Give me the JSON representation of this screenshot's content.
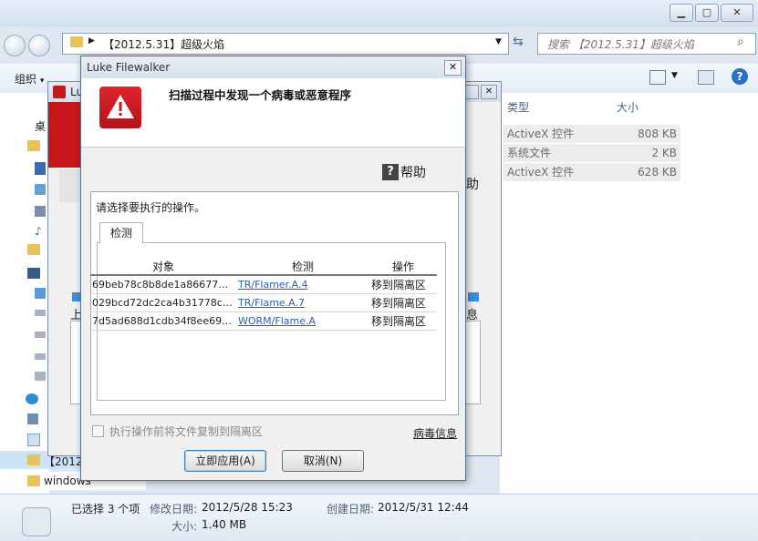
{
  "explorer": {
    "address": "【2012.5.31】超级火焰",
    "search_placeholder": "搜索 【2012.5.31】超级火焰",
    "organize_label": "组织",
    "organize_arrow": "▾",
    "columns": {
      "type": "类型",
      "size": "大小"
    },
    "files": [
      {
        "type": "ActiveX 控件",
        "size": "808 KB"
      },
      {
        "type": "系统文件",
        "size": "2 KB"
      },
      {
        "type": "ActiveX 控件",
        "size": "628 KB"
      }
    ],
    "folders": [
      "【2012",
      "windows"
    ],
    "sidebar_label": "桌",
    "details": {
      "selected": "已选择 3 个项",
      "modified_label": "修改日期:",
      "modified_value": "2012/5/28 15:23",
      "created_label": "创建日期:",
      "created_value": "2012/5/31 12:44",
      "size_label": "大小:",
      "size_value": "1.40 MB"
    }
  },
  "avira_window": {
    "title": "Lu",
    "help_fragment": "助",
    "info_fragment": "息",
    "sub_fragment": "上"
  },
  "dialog": {
    "title": "Luke Filewalker",
    "heading": "扫描过程中发现一个病毒或恶意程序",
    "help_label": "帮助",
    "prompt": "请选择要执行的操作。",
    "tab_label": "检测",
    "table": {
      "headers": [
        "对象",
        "检测",
        "操作"
      ],
      "rows": [
        {
          "object": "69beb78c8b8de1a86677e27c...",
          "detection": "TR/Flamer.A.4",
          "action": "移到隔离区"
        },
        {
          "object": "029bcd72dc2ca4b31778cf4ee...",
          "detection": "TR/Flame.A.7",
          "action": "移到隔离区"
        },
        {
          "object": "7d5ad688d1cdb34f8ee694e6...",
          "detection": "WORM/Flame.A",
          "action": "移到隔离区"
        }
      ]
    },
    "copy_checkbox_label": "执行操作前将文件复制到隔离区",
    "virus_info_link": "病毒信息",
    "apply_button": "立即应用(A)",
    "cancel_button": "取消(N)"
  },
  "colors": {
    "warning_red": "#c8161d",
    "link_blue": "#2a5db0"
  }
}
